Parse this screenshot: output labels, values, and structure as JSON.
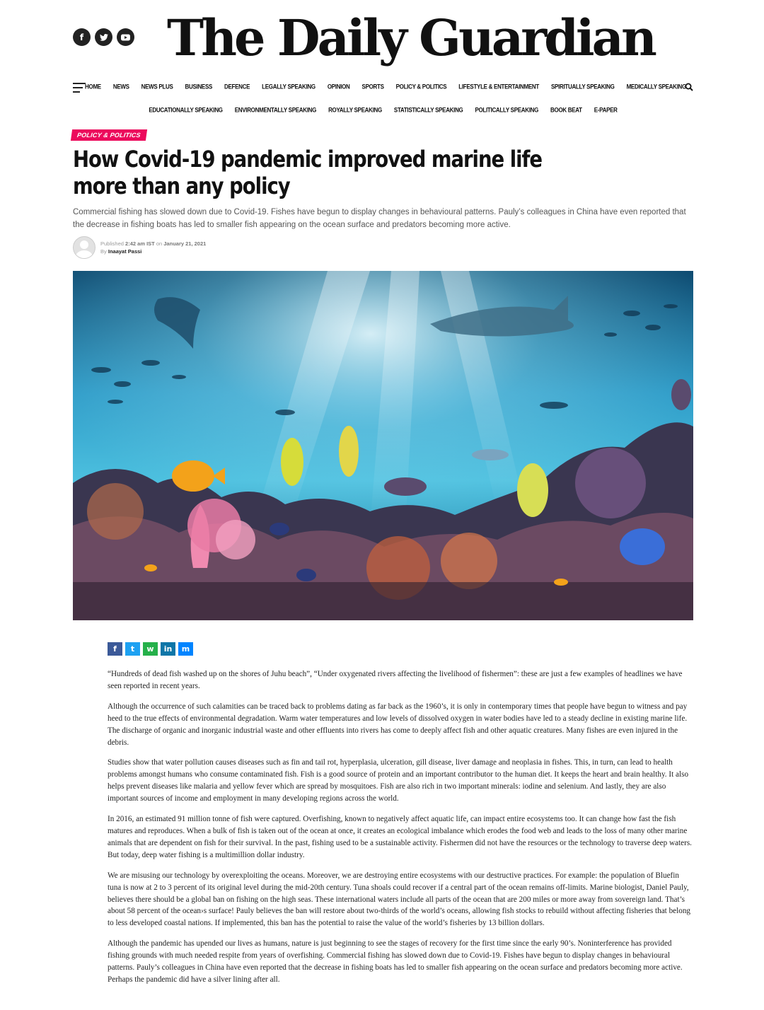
{
  "site": {
    "name": "The Daily Guardian",
    "social_icons": [
      "facebook-icon",
      "twitter-icon",
      "youtube-icon"
    ]
  },
  "nav": {
    "primary": [
      "HOME",
      "NEWS",
      "NEWS PLUS",
      "BUSINESS",
      "DEFENCE",
      "LEGALLY SPEAKING",
      "OPINION",
      "SPORTS",
      "POLICY & POLITICS",
      "LIFESTYLE & ENTERTAINMENT",
      "SPIRITUALLY SPEAKING",
      "MEDICALLY SPEAKING"
    ],
    "secondary": [
      "EDUCATIONALLY SPEAKING",
      "ENVIRONMENTALLY SPEAKING",
      "ROYALLY SPEAKING",
      "STATISTICALLY SPEAKING",
      "POLITICALLY SPEAKING",
      "BOOK BEAT",
      "E-PAPER"
    ]
  },
  "article": {
    "category": "POLICY & POLITICS",
    "title": "How Covid-19 pandemic improved marine life more than any policy",
    "summary": "Commercial fishing has slowed down due to Covid-19. Fishes have begun to display changes in behavioural patterns. Pauly’s colleagues in China have even reported that the decrease in fishing boats has led to smaller fish appearing on the ocean surface and predators becoming more active.",
    "published_prefix": "Published",
    "published_time": "2:42 am IST",
    "published_on": "on",
    "published_date": "January 21, 2021",
    "by": "By",
    "author": "Inaayat Passi",
    "share_icons": [
      {
        "name": "facebook-share-icon",
        "glyph": "f",
        "color": "#3b5998"
      },
      {
        "name": "twitter-share-icon",
        "glyph": "t",
        "color": "#1da1f2"
      },
      {
        "name": "whatsapp-share-icon",
        "glyph": "w",
        "color": "#25b04a"
      },
      {
        "name": "linkedin-share-icon",
        "glyph": "in",
        "color": "#0e76a8"
      },
      {
        "name": "messenger-share-icon",
        "glyph": "m",
        "color": "#0084ff"
      }
    ],
    "paragraphs": [
      "“Hundreds of dead fish washed up on the shores of Juhu beach”, “Under oxygenated rivers affecting the livelihood of fishermen”: these are just a few examples of headlines we have seen reported in recent years.",
      "Although the occurrence of such calamities can be traced back to problems dating as far back as the 1960’s, it is only in contemporary times that people have begun to witness and pay heed to the true effects of environmental degradation. Warm water temperatures and low levels of dissolved oxygen in water bodies have led to a steady decline in existing marine life. The discharge of organic and inorganic industrial waste and other effluents into rivers has come to deeply affect fish and other aquatic creatures. Many fishes are even injured in the debris.",
      "Studies show that water pollution causes diseases such as fin and tail rot, hyperplasia, ulceration, gill disease, liver damage and neoplasia in fishes. This, in turn, can lead to health problems amongst humans who consume contaminated fish. Fish is a good source of protein and an important contributor to the human diet. It keeps the heart and brain healthy. It also helps prevent diseases like malaria and yellow fever which are spread by mosquitoes. Fish are also rich in two important minerals: iodine and selenium. And lastly, they are also important sources of income and employment in many developing regions across the world.",
      "In 2016, an estimated 91 million tonne of fish were captured. Overfishing, known to negatively affect aquatic life, can impact entire ecosystems too. It can change how fast the fish matures and reproduces. When a bulk of fish is taken out of the ocean at once, it creates an ecological imbalance which erodes the food web and leads to the loss of many other marine animals that are dependent on fish for their survival. In the past, fishing used to be a sustainable activity. Fishermen did not have the resources or the technology to traverse deep waters. But today, deep water fishing is a multimillion dollar industry.",
      "We are misusing our technology by overexploiting the oceans. Moreover, we are destroying entire ecosystems with our destructive practices. For example: the population of Bluefin tuna is now at 2 to 3 percent of its original level during the mid-20th century. Tuna shoals could recover if a central part of the ocean remains off-limits. Marine biologist, Daniel Pauly, believes there should be a global ban on fishing on the high seas. These international waters include all parts of the ocean that are 200 miles or more away from sovereign land. That’s about 58 percent of the ocean›s surface! Pauly believes the ban will restore about two-thirds of the world’s oceans, allowing fish stocks to rebuild without affecting fisheries that belong to less developed coastal nations. If implemented, this ban has the potential to raise the value of the world’s fisheries by 13 billion dollars.",
      "Although the pandemic has upended our lives as humans, nature is just beginning to see the stages of recovery for the first time since the early 90’s. Noninterference has provided fishing grounds with much needed respite from years of overfishing. Commercial fishing has slowed down due to Covid-19. Fishes have begun to display changes in behavioural patterns. Pauly’s colleagues in China have even reported that the decrease in fishing boats has led to smaller fish appearing on the ocean surface and predators becoming more active. Perhaps the pandemic did have a silver lining after all."
    ]
  }
}
